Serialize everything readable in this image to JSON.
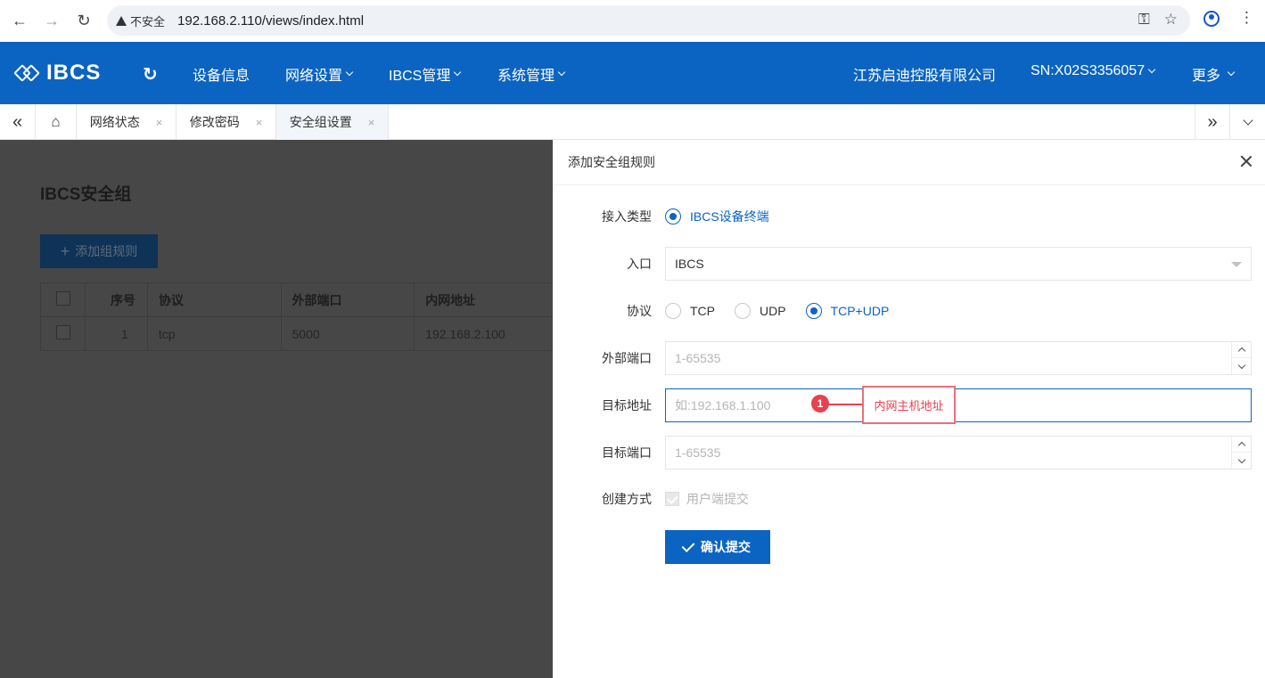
{
  "browser": {
    "security_label": "不安全",
    "url": "192.168.2.110/views/index.html"
  },
  "header": {
    "logo_text": "IBCS",
    "menu": [
      {
        "label": "设备信息",
        "has_caret": false
      },
      {
        "label": "网络设置",
        "has_caret": true
      },
      {
        "label": "IBCS管理",
        "has_caret": true
      },
      {
        "label": "系统管理",
        "has_caret": true
      }
    ],
    "company": "江苏启迪控股有限公司",
    "serial": "SN:X02S3356057",
    "more": "更多"
  },
  "tabs": [
    {
      "label": "网络状态",
      "active": false
    },
    {
      "label": "修改密码",
      "active": false
    },
    {
      "label": "安全组设置",
      "active": true
    }
  ],
  "background_page": {
    "title": "IBCS安全组",
    "add_button": "添加组规则",
    "table": {
      "columns": [
        "序号",
        "协议",
        "外部端口",
        "内网地址"
      ],
      "rows": [
        [
          "1",
          "tcp",
          "5000",
          "192.168.2.100"
        ]
      ]
    }
  },
  "drawer": {
    "title": "添加安全组规则",
    "access_type": {
      "label": "接入类型",
      "option": "IBCS设备终端"
    },
    "entry": {
      "label": "入口",
      "value": "IBCS"
    },
    "protocol": {
      "label": "协议",
      "options": [
        "TCP",
        "UDP",
        "TCP+UDP"
      ],
      "selected": "TCP+UDP"
    },
    "external_port": {
      "label": "外部端口",
      "placeholder": "1-65535"
    },
    "target_address": {
      "label": "目标地址",
      "placeholder": "如:192.168.1.100"
    },
    "target_port": {
      "label": "目标端口",
      "placeholder": "1-65535"
    },
    "create_method": {
      "label": "创建方式",
      "option": "用户端提交"
    },
    "submit": "确认提交"
  },
  "annotation": {
    "number": "1",
    "text": "内网主机地址"
  },
  "colors": {
    "primary": "#0b64c1",
    "annotation": "#e8414f"
  }
}
